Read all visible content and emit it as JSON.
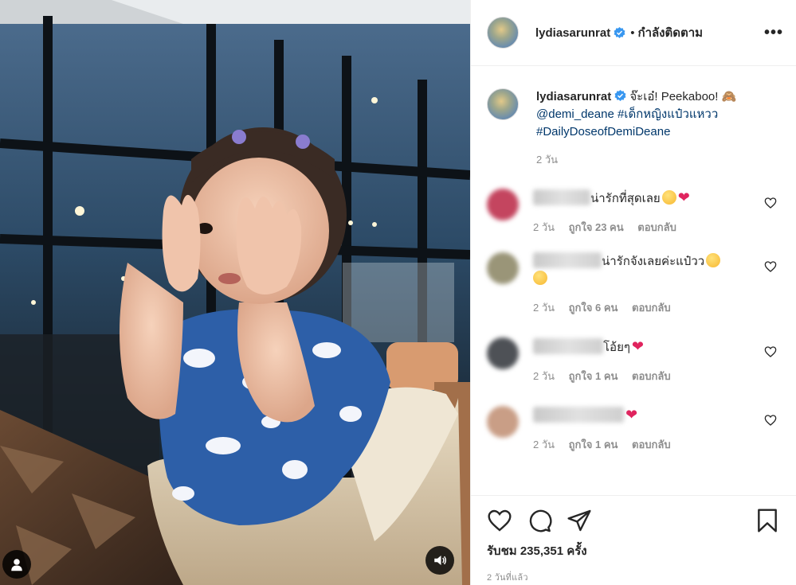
{
  "post": {
    "username": "lydiasarunrat",
    "follow_status": "กำลังติดตาม",
    "more_label": "•••",
    "caption": {
      "text": "จ๊ะเอ๋! Peekaboo! 🙈",
      "mention": "@demi_deane",
      "hashtag1": "#เด็กหญิงแป๋วแหวว",
      "hashtag2": "#DailyDoseofDemiDeane",
      "time": "2 วัน"
    },
    "comments": [
      {
        "text": "น่ารักที่สุดเลย",
        "emoji": "smile+heart",
        "time": "2 วัน",
        "likes": "ถูกใจ 23 คน",
        "reply": "ตอบกลับ",
        "avatar_color": "#c4455f"
      },
      {
        "text": "น่ารักจังเลยค่ะแป๋วว",
        "emoji": "smile",
        "time": "2 วัน",
        "likes": "ถูกใจ 6 คน",
        "reply": "ตอบกลับ",
        "avatar_color": "#9a9578"
      },
      {
        "text": "โอ้ยๆ",
        "emoji": "heart",
        "time": "2 วัน",
        "likes": "ถูกใจ 1 คน",
        "reply": "ตอบกลับ",
        "avatar_color": "#4e5156"
      },
      {
        "text": "",
        "emoji": "heart",
        "time": "2 วัน",
        "likes": "ถูกใจ 1 คน",
        "reply": "ตอบกลับ",
        "avatar_color": "#c99e86"
      }
    ],
    "views": "รับชม 235,351 ครั้ง",
    "posted": "2 วันที่แล้ว"
  },
  "icons": {
    "verified": "verified-badge-icon",
    "like": "heart-icon",
    "comment": "comment-bubble-icon",
    "share": "paper-plane-icon",
    "save": "bookmark-icon",
    "tag": "user-tag-icon",
    "mute": "speaker-icon"
  },
  "colors": {
    "verified": "#3897f0",
    "link": "#00376b",
    "muted_text": "#8e8e8e"
  }
}
